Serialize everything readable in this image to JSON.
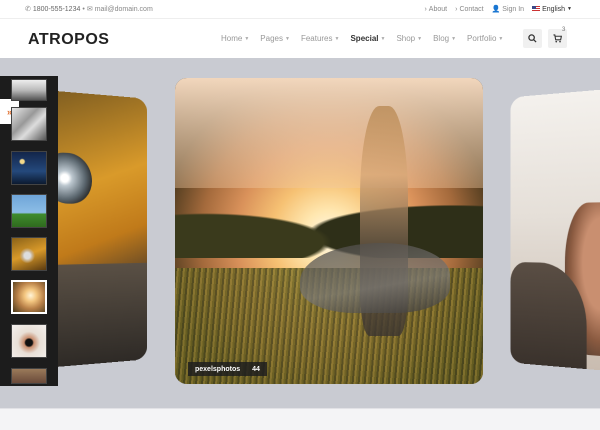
{
  "topbar": {
    "phone": "1800-555-1234",
    "separator": "•",
    "email": "mail@domain.com",
    "about": "About",
    "contact": "Contact",
    "signin": "Sign In",
    "language": "English"
  },
  "header": {
    "logo": "ATROPOS",
    "nav": [
      {
        "label": "Home"
      },
      {
        "label": "Pages"
      },
      {
        "label": "Features"
      },
      {
        "label": "Special"
      },
      {
        "label": "Shop"
      },
      {
        "label": "Blog"
      },
      {
        "label": "Portfolio"
      }
    ],
    "cart_count": "3"
  },
  "slider": {
    "caption_user": "pexelsphotos",
    "caption_count": "44",
    "side_tab_icon": "»"
  },
  "colors": {
    "accent": "#e06c2a",
    "slider_bg": "#c9cbd2",
    "panel_bg": "#1c1c1c"
  },
  "icons": [
    "phone-icon",
    "mail-icon",
    "about-icon",
    "contact-icon",
    "user-icon",
    "flag-icon",
    "search-icon",
    "cart-icon",
    "double-chevron-right-icon"
  ]
}
